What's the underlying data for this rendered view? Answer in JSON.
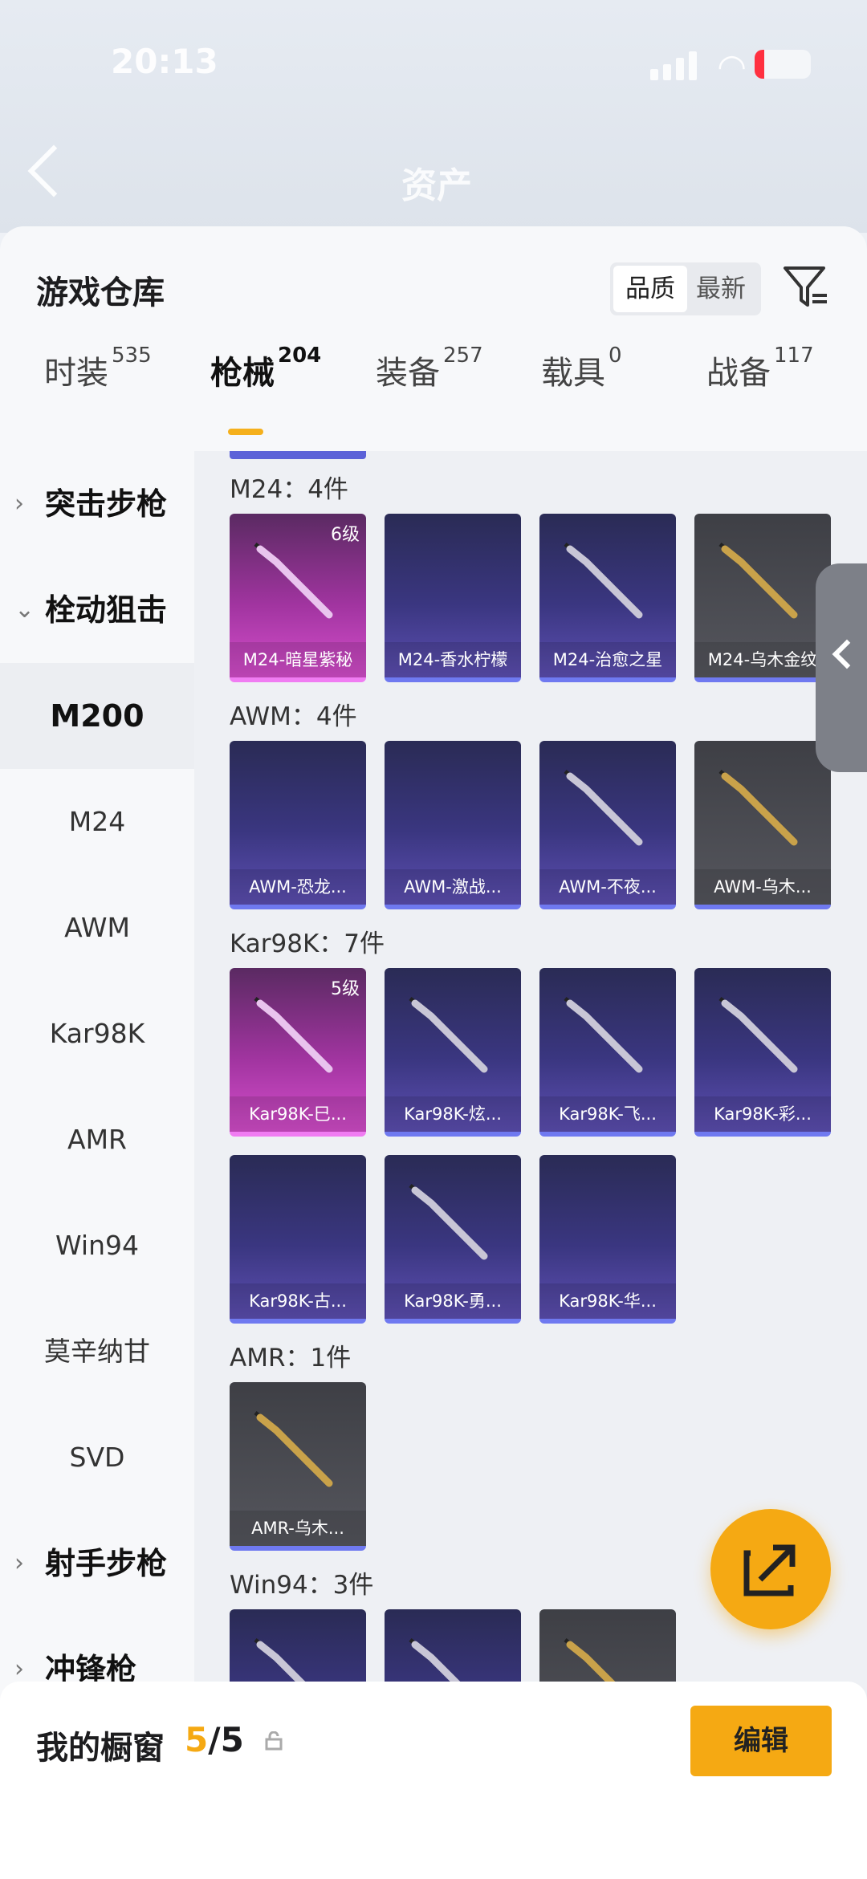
{
  "status": {
    "time": "20:13"
  },
  "nav": {
    "title": "资产"
  },
  "panel": {
    "title": "游戏仓库",
    "sort": {
      "active": "品质",
      "inactive": "最新"
    }
  },
  "tabs": [
    {
      "label": "时装",
      "count": "535"
    },
    {
      "label": "枪械",
      "count": "204"
    },
    {
      "label": "装备",
      "count": "257"
    },
    {
      "label": "载具",
      "count": "0"
    },
    {
      "label": "战备",
      "count": "117"
    }
  ],
  "sidebar": {
    "items": [
      {
        "label": "突击步枪",
        "type": "category",
        "chev": "›"
      },
      {
        "label": "栓动狙击",
        "type": "category",
        "chev": "⌄"
      },
      {
        "label": "M200",
        "type": "selected"
      },
      {
        "label": "M24",
        "type": "item"
      },
      {
        "label": "AWM",
        "type": "item"
      },
      {
        "label": "Kar98K",
        "type": "item"
      },
      {
        "label": "AMR",
        "type": "item"
      },
      {
        "label": "Win94",
        "type": "item"
      },
      {
        "label": "莫辛纳甘",
        "type": "item"
      },
      {
        "label": "SVD",
        "type": "item"
      },
      {
        "label": "射手步枪",
        "type": "category",
        "chev": "›"
      },
      {
        "label": "冲锋枪",
        "type": "category",
        "chev": "›"
      }
    ]
  },
  "sections": [
    {
      "title": "M24：4件",
      "items": [
        {
          "name": "M24-暗星紫秘",
          "level": "6级",
          "style": "purple",
          "gun": true
        },
        {
          "name": "M24-香水柠檬",
          "level": "",
          "style": "blue",
          "gun": false
        },
        {
          "name": "M24-治愈之星",
          "level": "",
          "style": "blue",
          "gun": true
        },
        {
          "name": "M24-乌木金纹",
          "level": "",
          "style": "gray",
          "gun": true
        }
      ]
    },
    {
      "title": "AWM：4件",
      "items": [
        {
          "name": "AWM-恐龙...",
          "level": "",
          "style": "blue",
          "gun": false
        },
        {
          "name": "AWM-激战...",
          "level": "",
          "style": "blue",
          "gun": false
        },
        {
          "name": "AWM-不夜...",
          "level": "",
          "style": "blue",
          "gun": true
        },
        {
          "name": "AWM-乌木...",
          "level": "",
          "style": "gray",
          "gun": true
        }
      ]
    },
    {
      "title": "Kar98K：7件",
      "items": [
        {
          "name": "Kar98K-巳...",
          "level": "5级",
          "style": "purple",
          "gun": true
        },
        {
          "name": "Kar98K-炫...",
          "level": "",
          "style": "blue",
          "gun": true
        },
        {
          "name": "Kar98K-飞...",
          "level": "",
          "style": "blue",
          "gun": true
        },
        {
          "name": "Kar98K-彩...",
          "level": "",
          "style": "blue",
          "gun": true
        },
        {
          "name": "Kar98K-古...",
          "level": "",
          "style": "blue",
          "gun": false
        },
        {
          "name": "Kar98K-勇...",
          "level": "",
          "style": "blue",
          "gun": true
        },
        {
          "name": "Kar98K-华...",
          "level": "",
          "style": "blue",
          "gun": false
        }
      ]
    },
    {
      "title": "AMR：1件",
      "items": [
        {
          "name": "AMR-乌木...",
          "level": "",
          "style": "gray",
          "gun": true
        }
      ]
    },
    {
      "title": "Win94：3件",
      "items": [
        {
          "name": "",
          "level": "",
          "style": "blue",
          "gun": true
        },
        {
          "name": "",
          "level": "",
          "style": "blue",
          "gun": true
        },
        {
          "name": "",
          "level": "",
          "style": "gray",
          "gun": true
        }
      ]
    }
  ],
  "showcase": {
    "title": "我的橱窗",
    "current": "5",
    "total": "/5",
    "edit_label": "编辑"
  },
  "icons": {
    "back": "chevron-left-icon",
    "filter": "filter-icon",
    "share": "share-icon",
    "lock": "lock-icon"
  },
  "colors": {
    "accent": "#f5a913",
    "purple_quality": "#d54ecc",
    "blue_quality": "#6f79f0"
  }
}
